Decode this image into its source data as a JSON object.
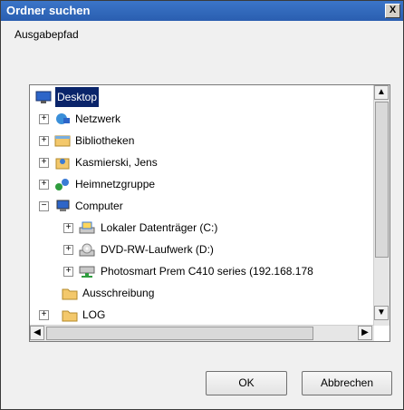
{
  "window": {
    "title": "Ordner suchen",
    "close_label": "X"
  },
  "description": "Ausgabepfad",
  "tree": [
    {
      "label": "Desktop",
      "selected": true
    },
    {
      "label": "Netzwerk"
    },
    {
      "label": "Bibliotheken"
    },
    {
      "label": "Kasmierski, Jens"
    },
    {
      "label": "Heimnetzgruppe"
    },
    {
      "label": "Computer"
    },
    {
      "label": "Lokaler Datenträger (C:)"
    },
    {
      "label": "DVD-RW-Laufwerk (D:)"
    },
    {
      "label": "Photosmart Prem C410 series (192.168.178"
    },
    {
      "label": "Ausschreibung"
    },
    {
      "label": "LOG"
    }
  ],
  "buttons": {
    "ok": "OK",
    "cancel": "Abbrechen"
  }
}
